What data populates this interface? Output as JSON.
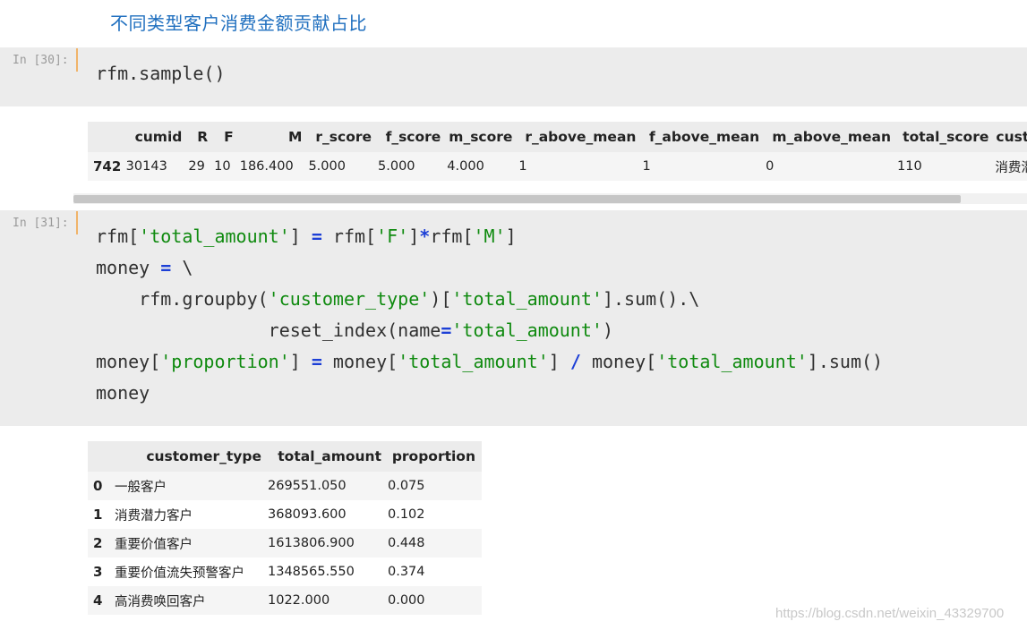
{
  "heading": "不同类型客户消费金额贡献占比",
  "cell30": {
    "prompt": "In [30]:",
    "code": "rfm.sample()"
  },
  "sample_table": {
    "columns": [
      "cumid",
      "R",
      "F",
      "M",
      "r_score",
      "f_score",
      "m_score",
      "r_above_mean",
      "f_above_mean",
      "m_above_mean",
      "total_score",
      "custor"
    ],
    "rows": [
      {
        "index": "742",
        "cells": [
          "30143",
          "29",
          "10",
          "186.400",
          "5.000",
          "5.000",
          "4.000",
          "1",
          "1",
          "0",
          "110",
          "消费潜力"
        ]
      }
    ]
  },
  "cell31": {
    "prompt": "In [31]:",
    "lines": [
      [
        [
          "n",
          "rfm["
        ],
        [
          "s",
          "'total_amount'"
        ],
        [
          "n",
          "] "
        ],
        [
          "o",
          "="
        ],
        [
          "n",
          " rfm["
        ],
        [
          "s",
          "'F'"
        ],
        [
          "n",
          "]"
        ],
        [
          "o",
          "*"
        ],
        [
          "n",
          "rfm["
        ],
        [
          "s",
          "'M'"
        ],
        [
          "n",
          "]"
        ]
      ],
      [
        [
          "n",
          "money "
        ],
        [
          "o",
          "="
        ],
        [
          "n",
          " \\"
        ]
      ],
      [
        [
          "n",
          "    rfm.groupby("
        ],
        [
          "s",
          "'customer_type'"
        ],
        [
          "n",
          ")["
        ],
        [
          "s",
          "'total_amount'"
        ],
        [
          "n",
          "].sum().\\"
        ]
      ],
      [
        [
          "n",
          "                reset_index(name"
        ],
        [
          "o",
          "="
        ],
        [
          "s",
          "'total_amount'"
        ],
        [
          "n",
          ")"
        ]
      ],
      [
        [
          "n",
          "money["
        ],
        [
          "s",
          "'proportion'"
        ],
        [
          "n",
          "] "
        ],
        [
          "o",
          "="
        ],
        [
          "n",
          " money["
        ],
        [
          "s",
          "'total_amount'"
        ],
        [
          "n",
          "] "
        ],
        [
          "o",
          "/"
        ],
        [
          "n",
          " money["
        ],
        [
          "s",
          "'total_amount'"
        ],
        [
          "n",
          "].sum()"
        ]
      ],
      [
        [
          "n",
          "money"
        ]
      ]
    ]
  },
  "money_table": {
    "columns": [
      "customer_type",
      "total_amount",
      "proportion"
    ],
    "rows": [
      {
        "index": "0",
        "cells": [
          "一般客户",
          "269551.050",
          "0.075"
        ]
      },
      {
        "index": "1",
        "cells": [
          "消费潜力客户",
          "368093.600",
          "0.102"
        ]
      },
      {
        "index": "2",
        "cells": [
          "重要价值客户",
          "1613806.900",
          "0.448"
        ]
      },
      {
        "index": "3",
        "cells": [
          "重要价值流失预警客户",
          "1348565.550",
          "0.374"
        ]
      },
      {
        "index": "4",
        "cells": [
          "高消费唤回客户",
          "1022.000",
          "0.000"
        ]
      }
    ]
  },
  "watermark": "https://blog.csdn.net/weixin_43329700",
  "colors": {
    "string": "#0f8a0f",
    "operator": "#1c3fd6",
    "heading": "#1f6fbf"
  }
}
